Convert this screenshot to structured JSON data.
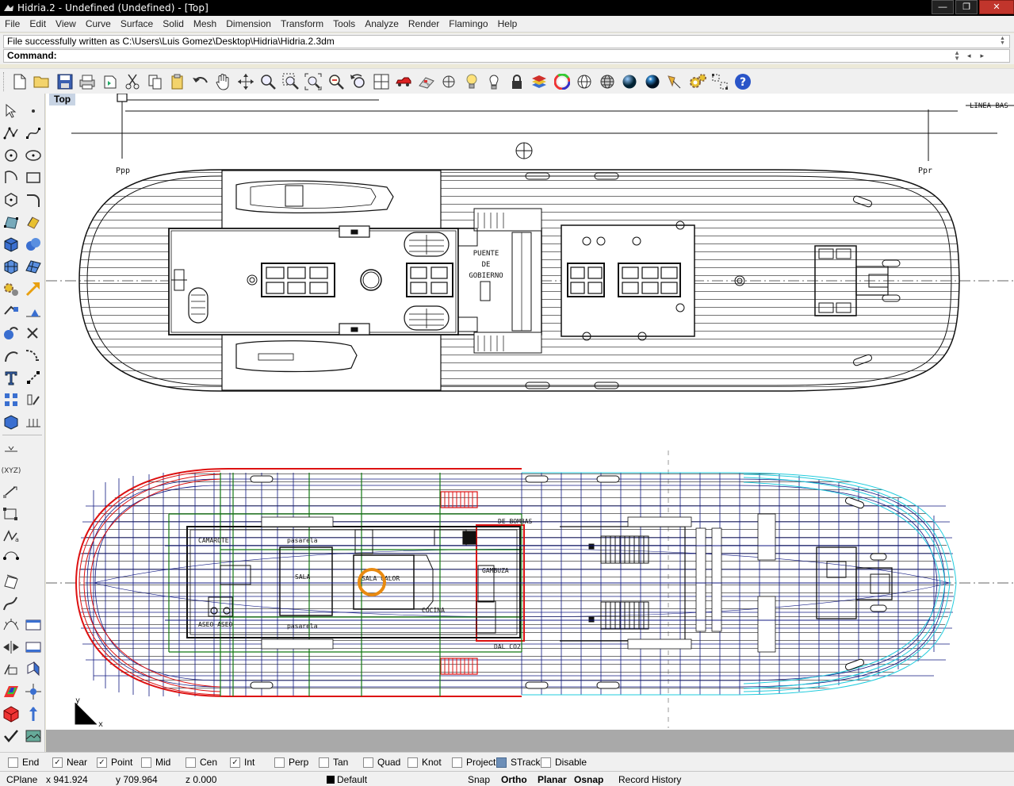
{
  "window": {
    "title": "Hidria.2 - Undefined (Undefined) - [Top]",
    "buttons": [
      "—",
      "❐",
      "✕"
    ]
  },
  "menu": [
    "File",
    "Edit",
    "View",
    "Curve",
    "Surface",
    "Solid",
    "Mesh",
    "Dimension",
    "Transform",
    "Tools",
    "Analyze",
    "Render",
    "Flamingo",
    "Help"
  ],
  "command": {
    "history_text": "File successfully written as C:\\Users\\Luis Gomez\\Desktop\\Hidria\\Hidria.2.3dm",
    "prompt_label": "Command:",
    "value": ""
  },
  "toolbar_icons": [
    "new-icon",
    "open-icon",
    "save-icon",
    "print-icon",
    "import-icon",
    "cut-icon",
    "copy-icon",
    "paste-icon",
    "undo-icon",
    "pan-hand-icon",
    "rotate-view-icon",
    "zoom-icon",
    "zoom-window-icon",
    "zoom-extents-icon",
    "zoom-selected-icon",
    "undo-view-icon",
    "four-viewports-icon",
    "car-icon",
    "render-grid-icon",
    "select-point-icon",
    "light-bulb-icon",
    "lamp-icon",
    "lock-icon",
    "layers-icon",
    "color-wheel-icon",
    "wireframe-sphere-icon",
    "ghosted-sphere-icon",
    "shaded-sphere-icon",
    "rendered-sphere-icon",
    "spotlight-icon",
    "options-gear-icon",
    "point-grid-icon",
    "help-icon"
  ],
  "viewport": {
    "label": "Top",
    "labels": {
      "ppp": "Ppp",
      "ppr": "Ppr",
      "linea_base": "LINEA BAS",
      "puente": "PUENTE",
      "de": "DE",
      "gobierno": "GOBIERNO",
      "camarote": "CAMAROTE",
      "pasarela_top": "pasarela",
      "pasarela_bottom": "pasarela",
      "sala": "SALA",
      "sala_calor": "SALA CALOR",
      "cocina": "COCINA",
      "gambuza": "GAMBUZA",
      "aseo": "ASEO  ASEO",
      "bombas": "DE BOMBAS",
      "co2": "DAL CO2"
    },
    "axis": {
      "x": "x",
      "y": "y"
    },
    "colors": {
      "red": "#dd1111",
      "green": "#117711",
      "blue": "#101880",
      "cyan": "#22ccdd",
      "orange": "#e88a10"
    }
  },
  "osnaps": [
    {
      "label": "End",
      "checked": false
    },
    {
      "label": "Near",
      "checked": true
    },
    {
      "label": "Point",
      "checked": true
    },
    {
      "label": "Mid",
      "checked": false
    },
    {
      "label": "Cen",
      "checked": false
    },
    {
      "label": "Int",
      "checked": true
    },
    {
      "label": "Perp",
      "checked": false
    },
    {
      "label": "Tan",
      "checked": false
    },
    {
      "label": "Quad",
      "checked": false
    },
    {
      "label": "Knot",
      "checked": false
    },
    {
      "label": "Project",
      "checked": false
    },
    {
      "label": "STrack",
      "checked": false
    },
    {
      "label": "Disable",
      "checked": false
    }
  ],
  "status": {
    "cplane": "CPlane",
    "x": "x 941.924",
    "y": "y 709.964",
    "z": "z 0.000",
    "layer": "Default",
    "snap": "Snap",
    "ortho": "Ortho",
    "planar": "Planar",
    "osnap": "Osnap",
    "record_history": "Record History"
  }
}
